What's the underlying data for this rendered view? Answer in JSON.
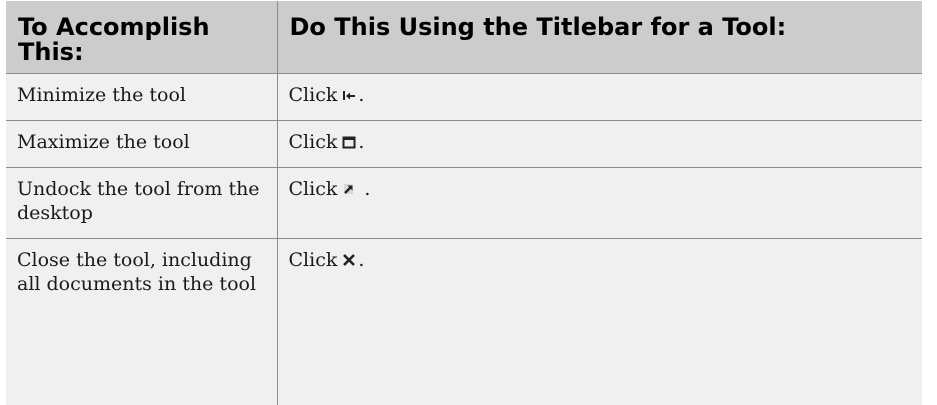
{
  "table": {
    "headers": [
      "To Accomplish This:",
      "Do This Using the Titlebar for a Tool:"
    ],
    "rows": [
      {
        "task": "Minimize the tool",
        "prefix": "Click",
        "icon": "minimize-to-edge-icon",
        "suffix": "."
      },
      {
        "task": "Maximize the tool",
        "prefix": "Click",
        "icon": "maximize-square-icon",
        "suffix": "."
      },
      {
        "task": "Undock the tool from the desktop",
        "prefix": "Click",
        "icon": "undock-arrow-icon",
        "suffix": " ."
      },
      {
        "task": "Close the tool, including all documents in the tool",
        "prefix": "Click",
        "icon": "close-x-icon",
        "suffix": "."
      }
    ]
  },
  "colors": {
    "header_bg": "#cccccc",
    "cell_bg": "#f0f0f0",
    "border": "#8c8c8c"
  }
}
